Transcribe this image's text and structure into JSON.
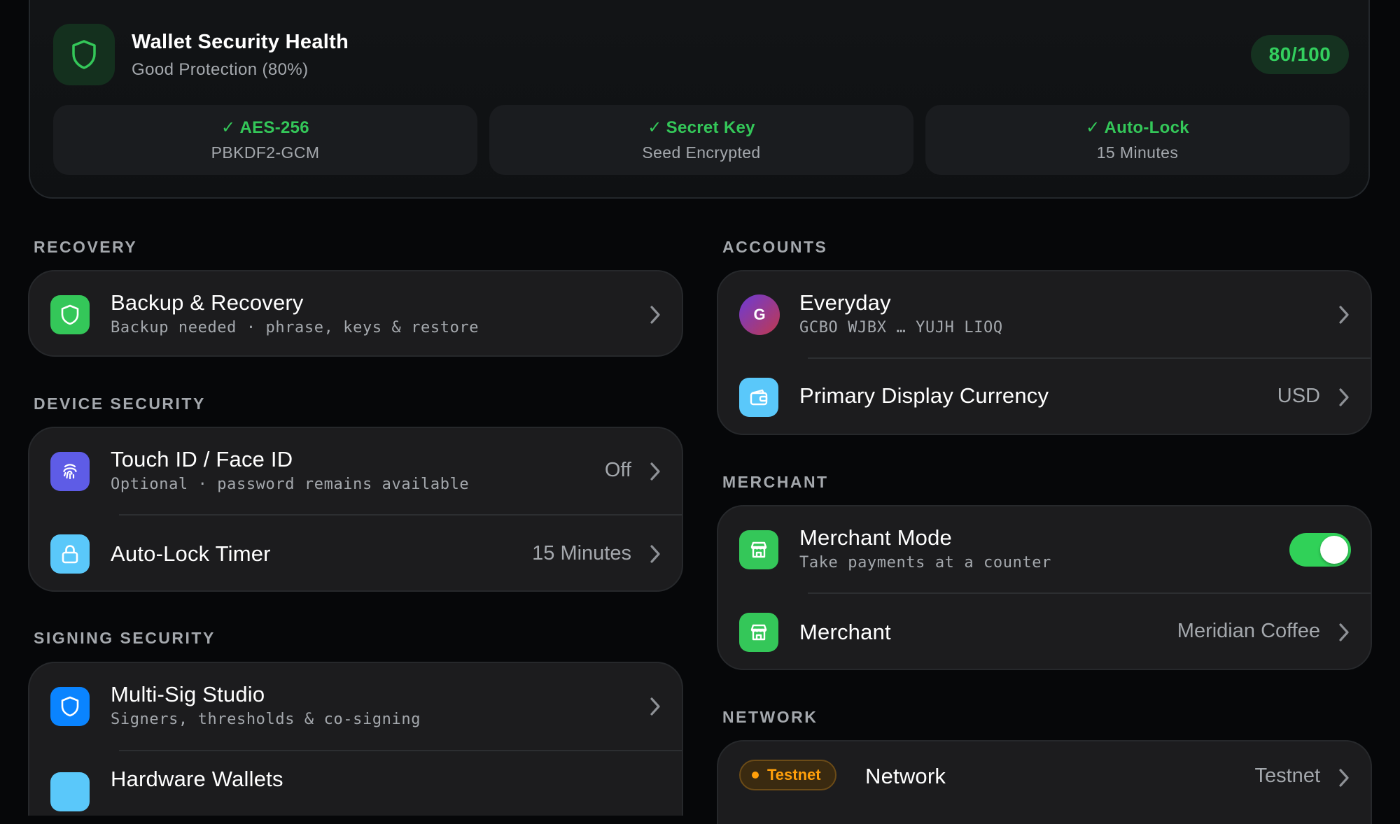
{
  "health": {
    "title": "Wallet Security Health",
    "subtitle": "Good Protection (80%)",
    "score": "80/100",
    "score_fraction": 0.8,
    "icon": "shield-icon",
    "features": [
      {
        "title": "AES-256",
        "subtitle": "PBKDF2-GCM"
      },
      {
        "title": "Secret Key",
        "subtitle": "Seed Encrypted"
      },
      {
        "title": "Auto-Lock",
        "subtitle": "15 Minutes"
      }
    ]
  },
  "sections": {
    "recovery": "RECOVERY",
    "device_security": "DEVICE SECURITY",
    "signing_security": "SIGNING SECURITY",
    "accounts": "ACCOUNTS",
    "merchant": "MERCHANT",
    "network": "NETWORK"
  },
  "recovery": {
    "backup": {
      "title": "Backup & Recovery",
      "subtitle": "Backup needed · phrase, keys & restore",
      "icon": "shield-icon"
    }
  },
  "device": {
    "biometric": {
      "title": "Touch ID / Face ID",
      "subtitle": "Optional · password remains available",
      "value": "Off",
      "icon": "fingerprint-icon"
    },
    "autolock": {
      "title": "Auto-Lock Timer",
      "value": "15 Minutes",
      "icon": "lock-icon"
    }
  },
  "signing": {
    "multisig": {
      "title": "Multi-Sig Studio",
      "subtitle": "Signers, thresholds & co-signing",
      "icon": "shield-icon"
    },
    "hardware": {
      "title": "Hardware Wallets",
      "icon": "hardware-wallet-icon"
    }
  },
  "accounts": {
    "everyday": {
      "title": "Everyday",
      "address": "GCBO WJBX … YUJH LIOQ",
      "avatar": "G"
    },
    "currency": {
      "title": "Primary Display Currency",
      "value": "USD",
      "icon": "wallet-icon"
    }
  },
  "merchant": {
    "mode": {
      "title": "Merchant Mode",
      "subtitle": "Take payments at a counter",
      "enabled": true,
      "icon": "storefront-icon"
    },
    "merchant": {
      "title": "Merchant",
      "value": "Meridian Coffee",
      "icon": "storefront-icon"
    }
  },
  "network": {
    "badge": "Testnet",
    "title": "Network",
    "value": "Testnet"
  },
  "colors": {
    "background": "#060709",
    "card": "#1c1c1e",
    "accent_green": "#34c759",
    "accent_blue": "#0a84ff",
    "accent_cyan": "#5ac8fa",
    "accent_purple": "#5e5ce6",
    "accent_orange": "#ff9f0a"
  }
}
